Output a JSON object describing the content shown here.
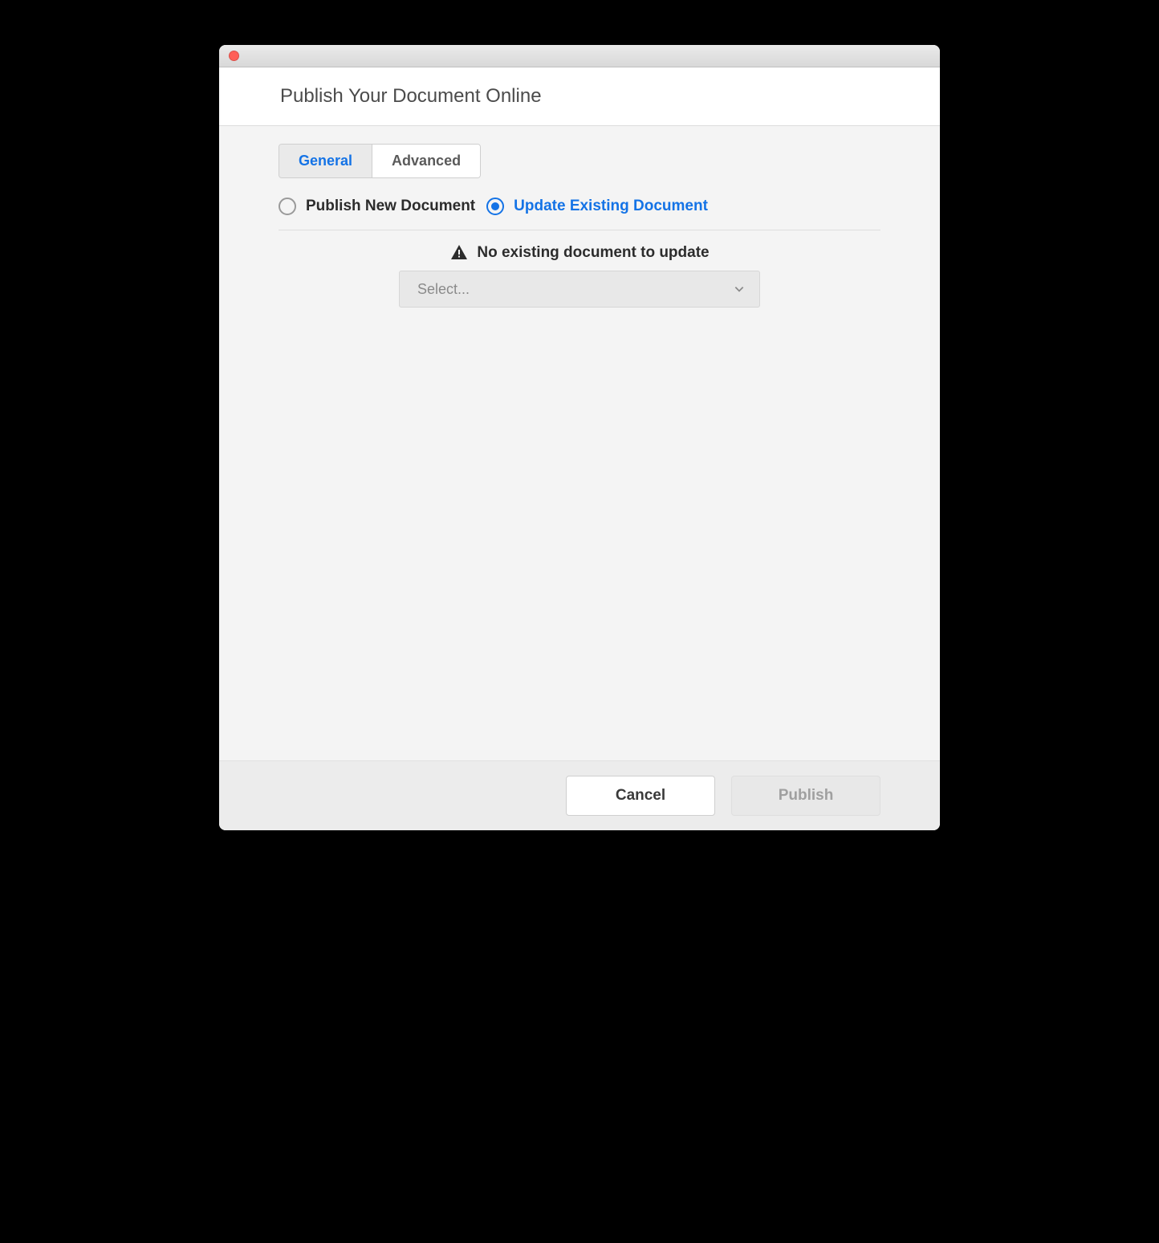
{
  "header": {
    "title": "Publish Your Document Online"
  },
  "tabs": {
    "general": "General",
    "advanced": "Advanced"
  },
  "radios": {
    "publish_new": "Publish New Document",
    "update_existing": "Update Existing Document"
  },
  "warning": {
    "text": "No existing document to update"
  },
  "select": {
    "placeholder": "Select..."
  },
  "buttons": {
    "cancel": "Cancel",
    "publish": "Publish"
  }
}
